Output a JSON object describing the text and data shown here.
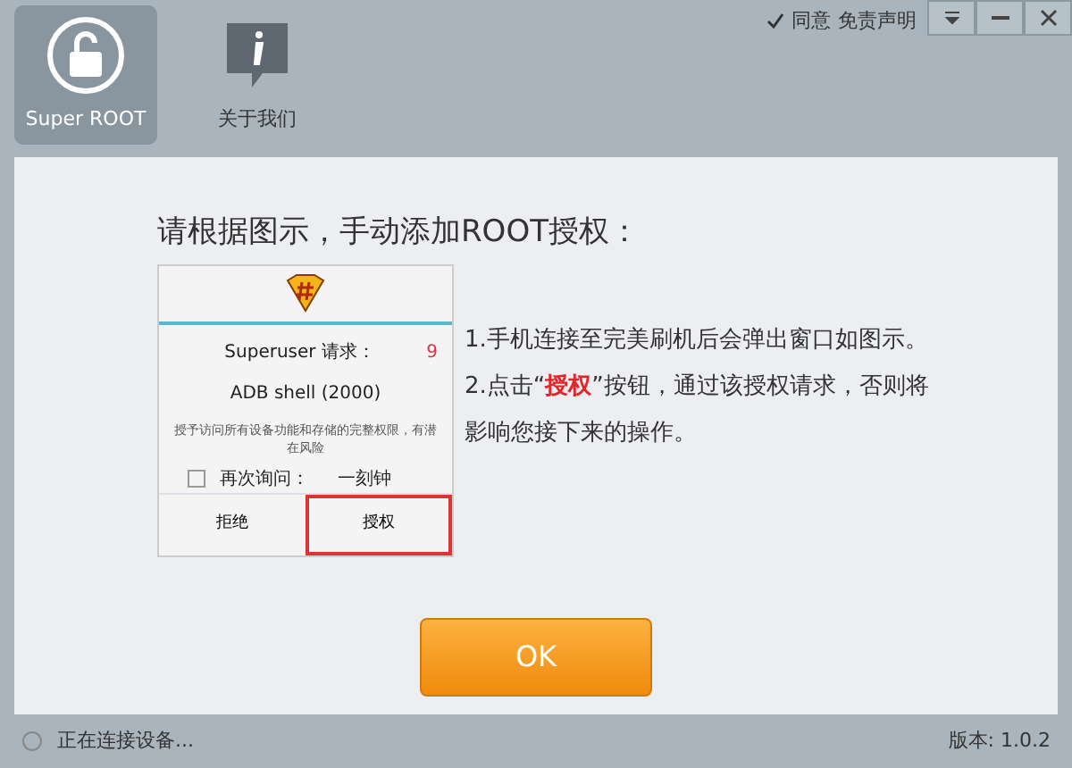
{
  "window": {
    "agree": {
      "label": "同意",
      "checked": true
    },
    "disclaimer": "免责声明"
  },
  "tabs": [
    {
      "label": "Super ROOT",
      "selected": true,
      "kind": "lock"
    },
    {
      "label": "关于我们",
      "selected": false,
      "kind": "info"
    }
  ],
  "heading": "请根据图示，手动添加ROOT授权：",
  "phone_dialog": {
    "title": "Superuser 请求：",
    "count": "9",
    "app": "ADB shell (2000)",
    "warning": "授予访问所有设备功能和存储的完整权限，有潜在风险",
    "remember": {
      "label": "再次询问：",
      "checked": false,
      "duration": "一刻钟"
    },
    "buttons": [
      {
        "label": "拒绝",
        "highlighted": false
      },
      {
        "label": "授权",
        "highlighted": true
      }
    ]
  },
  "steps": [
    "1.手机连接至完美刷机后会弹出窗口如图示。",
    "2.点击“**授权**”按钮，通过该授权请求，否则将影响您接下来的操作。"
  ],
  "ok_button": "OK",
  "status": "正在连接设备...",
  "version": "版本: 1.0.2"
}
